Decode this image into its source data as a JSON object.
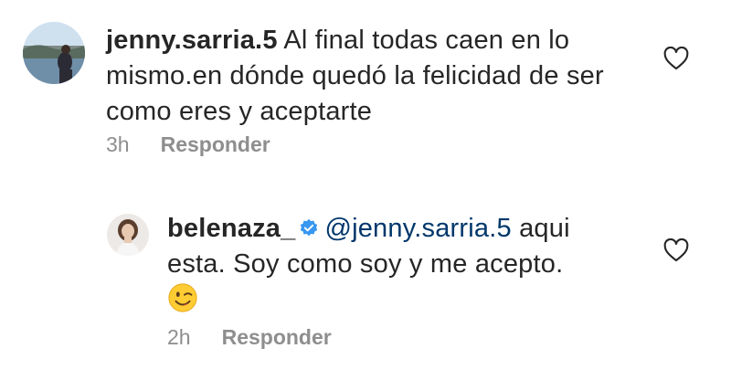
{
  "comments": [
    {
      "username": "jenny.sarria.5",
      "text": "Al final todas caen en lo mismo.en dónde quedó la felicidad de ser como eres y aceptarte",
      "time": "3h",
      "reply_label": "Responder"
    },
    {
      "username": "belenaza_",
      "verified": true,
      "mention": "@jenny.sarria.5",
      "text": "aqui esta. Soy como soy y me acepto.",
      "emoji": "winking-face",
      "time": "2h",
      "reply_label": "Responder"
    }
  ],
  "colors": {
    "text": "#262626",
    "muted": "#8e8e8e",
    "mention": "#00376b",
    "verified": "#3897f0"
  }
}
